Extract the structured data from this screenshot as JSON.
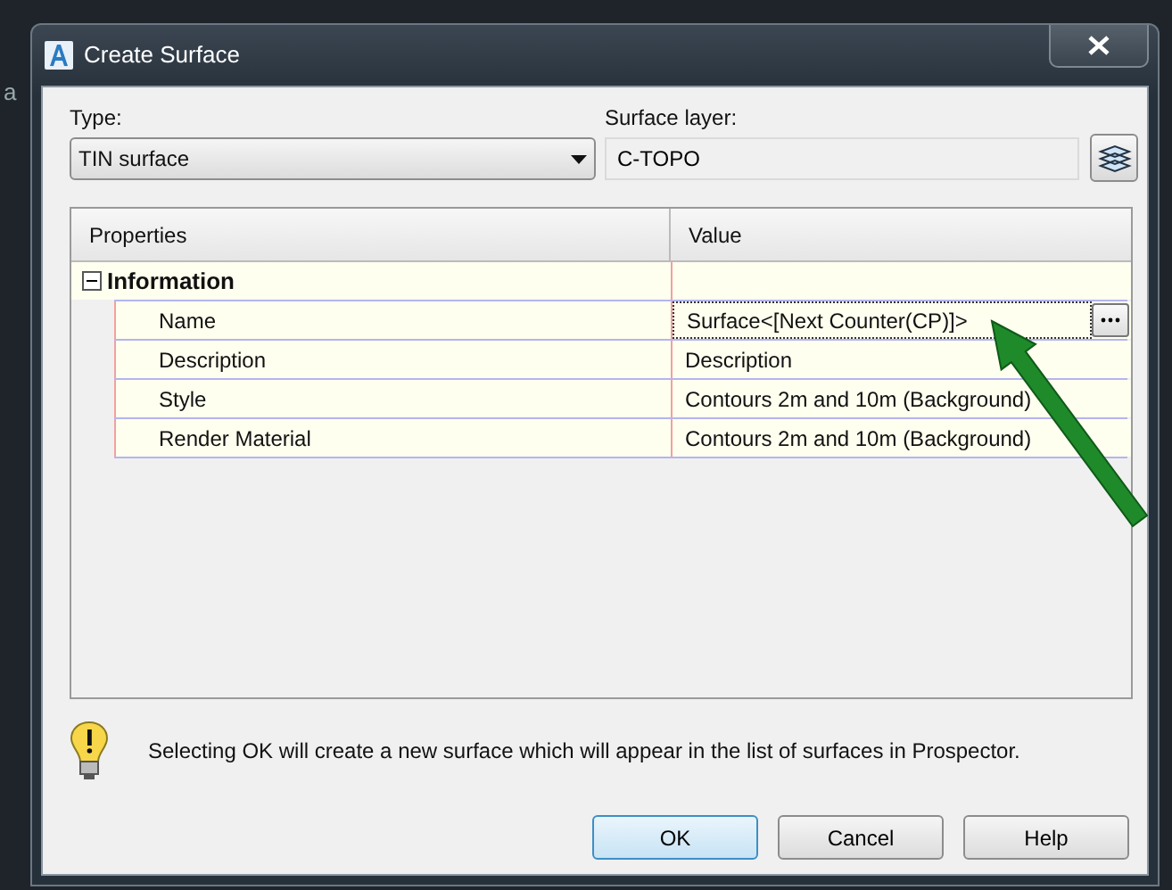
{
  "background_text": "a",
  "window": {
    "title": "Create Surface"
  },
  "type": {
    "label": "Type:",
    "value": "TIN surface"
  },
  "surface_layer": {
    "label": "Surface layer:",
    "value": "C-TOPO"
  },
  "grid": {
    "columns": [
      "Properties",
      "Value"
    ],
    "groups": [
      {
        "name": "Information",
        "expanded": true,
        "rows": [
          {
            "property": "Name",
            "value": "Surface<[Next Counter(CP)]>",
            "selected": true
          },
          {
            "property": "Description",
            "value": "Description",
            "selected": false
          },
          {
            "property": "Style",
            "value": "Contours 2m and 10m (Background)",
            "selected": false
          },
          {
            "property": "Render Material",
            "value": "Contours 2m and 10m (Background)",
            "selected": false
          }
        ]
      }
    ]
  },
  "message": "Selecting OK will create a new surface which will appear in the list of surfaces in Prospector.",
  "buttons": [
    {
      "label": "OK",
      "default": true
    },
    {
      "label": "Cancel",
      "default": false
    },
    {
      "label": "Help",
      "default": false
    }
  ]
}
